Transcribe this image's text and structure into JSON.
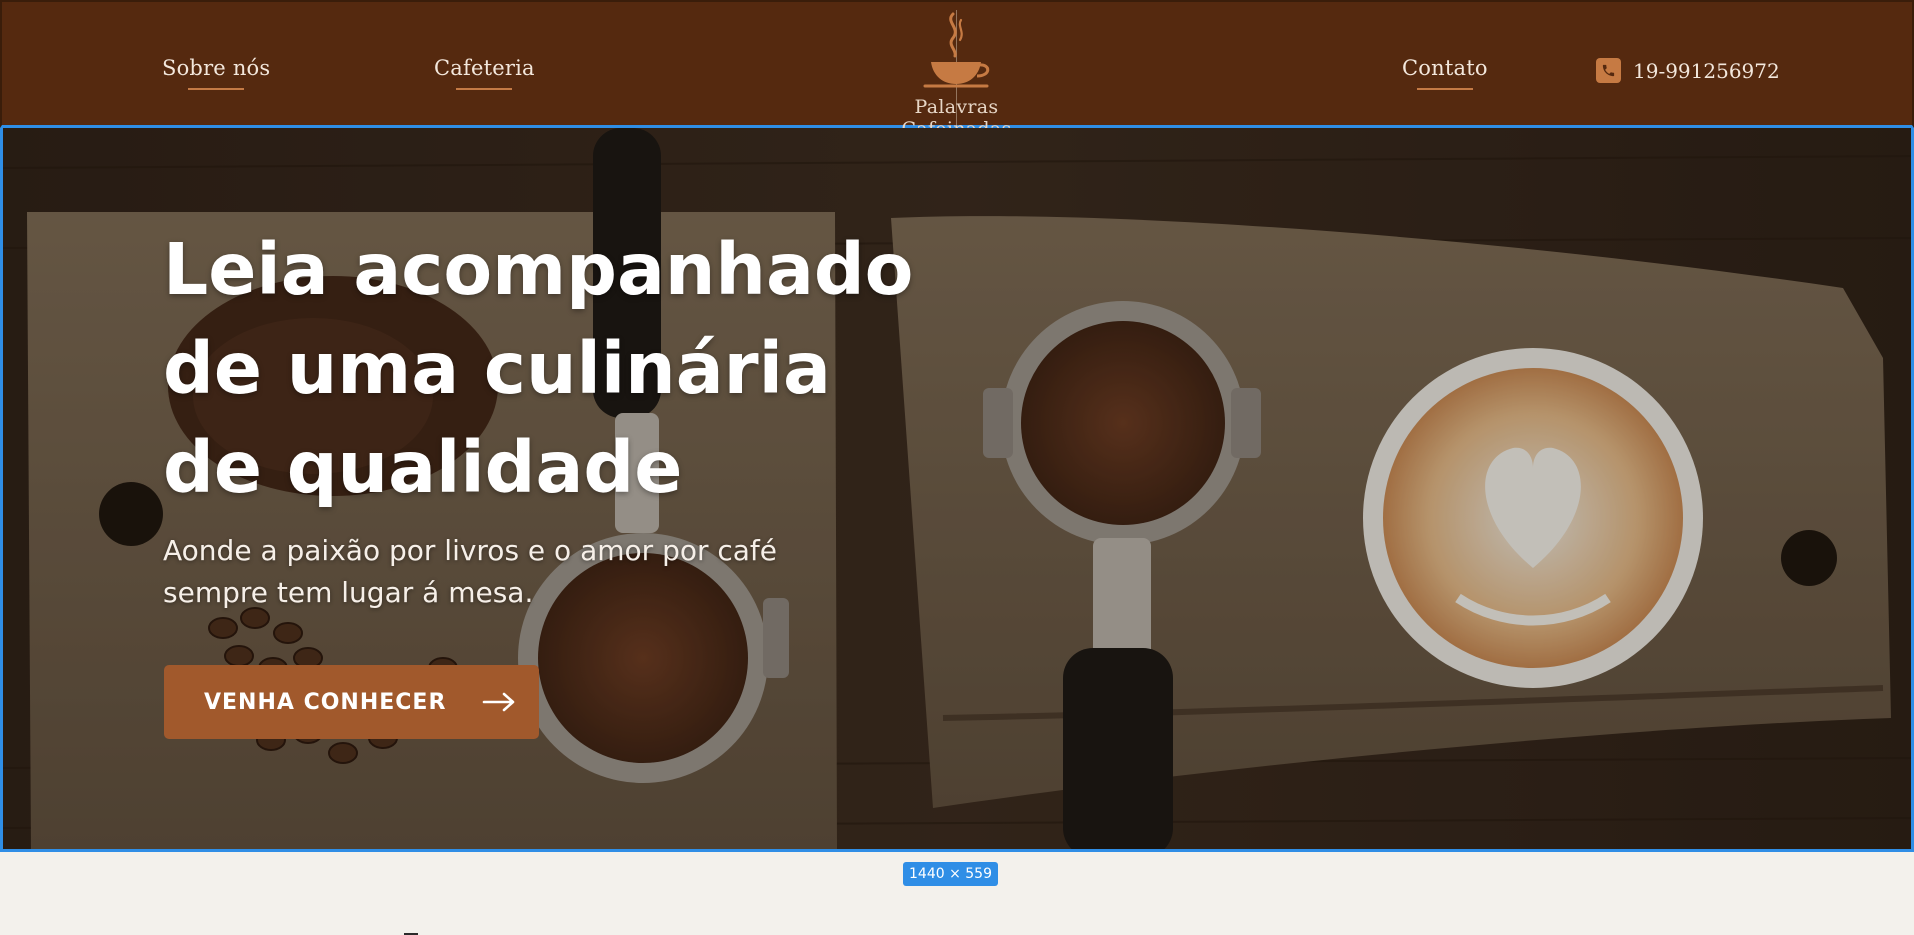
{
  "nav": {
    "left_links": [
      "Sobre nós",
      "Cafeteria"
    ],
    "right_link": "Contato",
    "phone": "19-991256972",
    "icons": {
      "phone": "phone-icon",
      "logo": "coffee-cup-icon"
    }
  },
  "brand": {
    "name": "Palavras Cafeinadas"
  },
  "hero": {
    "title": "Leia acompanhado de uma culinária de qualidade",
    "subtitle": "Aonde a paixão por livros e o amor por café sempre  tem lugar á mesa.",
    "cta_label": "VENHA CONHECER",
    "cta_icon": "arrow-right-icon"
  },
  "frame_badge": "1440 × 559",
  "colors": {
    "header_bg": "#55290f",
    "accent": "#c47a45",
    "cta_bg": "#a1592c",
    "selection": "#2f8ee6",
    "page_bg": "#f3f1ec"
  }
}
